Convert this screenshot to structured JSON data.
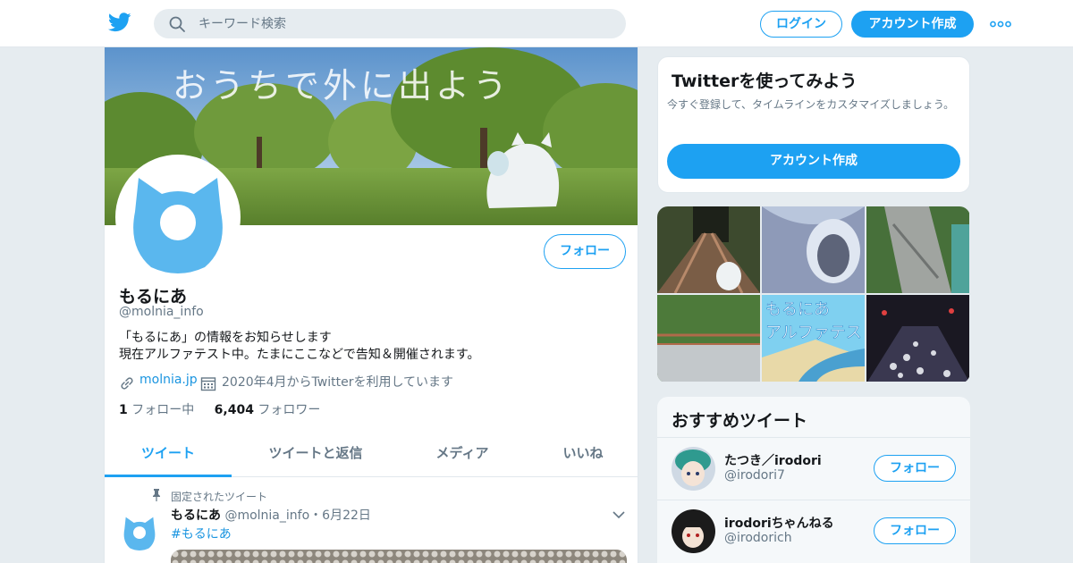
{
  "colors": {
    "accent": "#1da1f2",
    "link": "#1b95e0",
    "muted": "#657786",
    "background": "#e6ecf0"
  },
  "header": {
    "logo_icon": "twitter-bird-icon",
    "search_placeholder": "キーワード検索",
    "login_label": "ログイン",
    "signup_label": "アカウント作成",
    "more_icon": "more-dots-icon"
  },
  "profile": {
    "banner_text": "おうちで外に出よう",
    "name": "もるにあ",
    "handle": "@molnia_info",
    "follow_label": "フォロー",
    "bio": "「もるにあ」の情報をお知らせします\n現在アルファテスト中。たまにここなどで告知＆開催されます。",
    "website": "molnia.jp",
    "joined": "2020年4月からTwitterを利用しています",
    "following_count": "1",
    "following_label": "フォロー中",
    "followers_count": "6,404",
    "followers_label": "フォロワー"
  },
  "tabs": [
    "ツイート",
    "ツイートと返信",
    "メディア",
    "いいね"
  ],
  "pinned_tweet": {
    "pinned_label": "固定されたツイート",
    "author": "もるにあ",
    "handle": "@molnia_info",
    "separator": "・",
    "date": "6月22日",
    "text": "#もるにあ"
  },
  "signup_card": {
    "title": "Twitterを使ってみよう",
    "description": "今すぐ登録して、タイムラインをカスタマイズしましょう。",
    "button_label": "アカウント作成"
  },
  "media_grid": {
    "overlay_line1": "もるにあ",
    "overlay_line2": "アルファテス"
  },
  "recommended": {
    "title": "おすすめツイート",
    "items": [
      {
        "name": "たつき／irodori",
        "handle": "@irodori7",
        "follow_label": "フォロー"
      },
      {
        "name": "irodoriちゃんねる",
        "handle": "@irodorich",
        "follow_label": "フォロー"
      }
    ]
  }
}
